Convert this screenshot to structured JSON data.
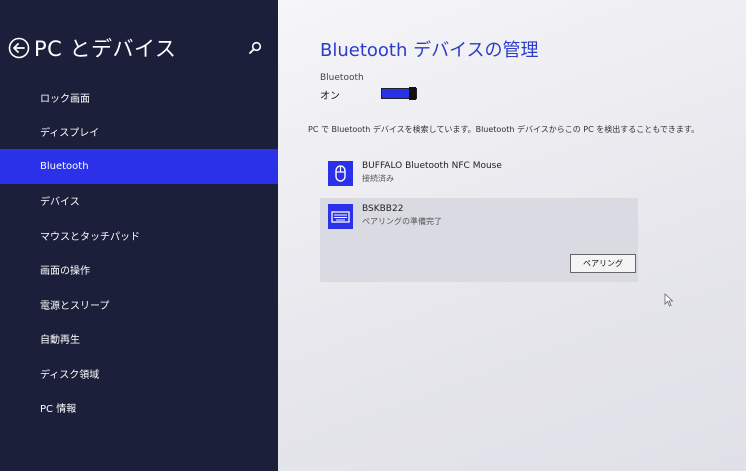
{
  "sidebar": {
    "title": "PC とデバイス",
    "items": [
      {
        "label": "ロック画面"
      },
      {
        "label": "ディスプレイ"
      },
      {
        "label": "Bluetooth"
      },
      {
        "label": "デバイス"
      },
      {
        "label": "マウスとタッチパッド"
      },
      {
        "label": "画面の操作"
      },
      {
        "label": "電源とスリープ"
      },
      {
        "label": "自動再生"
      },
      {
        "label": "ディスク領域"
      },
      {
        "label": "PC 情報"
      }
    ],
    "selected_index": 2
  },
  "main": {
    "title": "Bluetooth デバイスの管理",
    "bluetooth_label": "Bluetooth",
    "bluetooth_state": "オン",
    "description": "PC で Bluetooth デバイスを検索しています。Bluetooth デバイスからこの PC を検出することもできます。",
    "devices": [
      {
        "name": "BUFFALO Bluetooth NFC Mouse",
        "status": "接続済み",
        "icon": "mouse-icon"
      },
      {
        "name": "BSKBB22",
        "status": "ペアリングの準備完了",
        "icon": "keyboard-icon"
      }
    ],
    "pair_button": "ペアリング"
  },
  "colors": {
    "sidebar_bg": "#1c1f3a",
    "accent": "#2a31e8",
    "title": "#2a3cc8"
  }
}
